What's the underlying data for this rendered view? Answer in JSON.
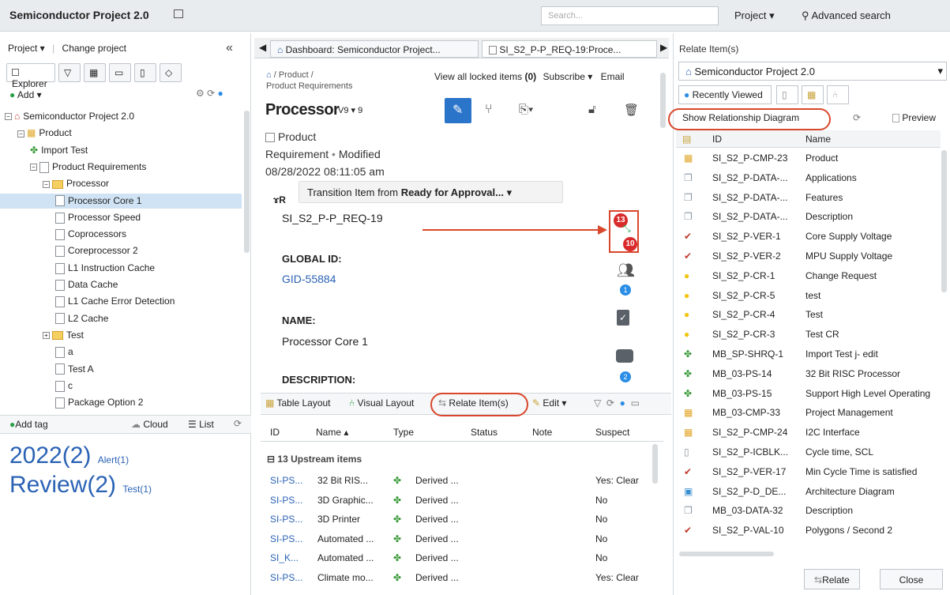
{
  "topbar": {
    "title": "Semiconductor Project 2.0",
    "search_placeholder": "Search...",
    "scope": "Project",
    "advanced": "Advanced search"
  },
  "left": {
    "project_menu": "Project ▾",
    "change_project": "Change project",
    "collapse": "«",
    "explorer_tab": "Explorer",
    "add": "Add ▾",
    "tree": [
      {
        "label": "Semiconductor Project 2.0",
        "level": 0,
        "kind": "project",
        "expander": "−"
      },
      {
        "label": "Product",
        "level": 1,
        "kind": "folder-grid",
        "expander": "−"
      },
      {
        "label": "Import Test",
        "level": 2,
        "kind": "puzzle",
        "expander": ""
      },
      {
        "label": "Product Requirements",
        "level": 2,
        "kind": "doc",
        "expander": "−"
      },
      {
        "label": "Processor",
        "level": 3,
        "kind": "folder",
        "expander": "−"
      },
      {
        "label": "Processor Core 1",
        "level": 4,
        "kind": "doc",
        "expander": "",
        "selected": true
      },
      {
        "label": "Processor Speed",
        "level": 4,
        "kind": "doc",
        "expander": ""
      },
      {
        "label": "Coprocessors",
        "level": 4,
        "kind": "doc",
        "expander": ""
      },
      {
        "label": "Coreprocessor 2",
        "level": 4,
        "kind": "doc",
        "expander": ""
      },
      {
        "label": "L1 Instruction Cache",
        "level": 4,
        "kind": "doc",
        "expander": ""
      },
      {
        "label": "Data Cache",
        "level": 4,
        "kind": "doc",
        "expander": ""
      },
      {
        "label": "L1 Cache Error Detection",
        "level": 4,
        "kind": "doc",
        "expander": ""
      },
      {
        "label": "L2 Cache",
        "level": 4,
        "kind": "doc",
        "expander": ""
      },
      {
        "label": "Test",
        "level": 3,
        "kind": "folder",
        "expander": "+"
      },
      {
        "label": "a",
        "level": 4,
        "kind": "doc",
        "expander": ""
      },
      {
        "label": "Test A",
        "level": 4,
        "kind": "doc",
        "expander": ""
      },
      {
        "label": "c",
        "level": 4,
        "kind": "doc",
        "expander": ""
      },
      {
        "label": "Package Option 2",
        "level": 4,
        "kind": "doc",
        "expander": ""
      }
    ],
    "add_tag": "Add tag",
    "cloud": "Cloud",
    "list": "List",
    "tag1_big": "2022(2)",
    "tag1_small": "Alert(1)",
    "tag2_big": "Review(2)",
    "tag2_small": "Test(1)"
  },
  "middle": {
    "tab1": "Dashboard: Semiconductor Project...",
    "tab2": "SI_S2_P-P_REQ-19:Proce...",
    "crumb1": "/ Product /",
    "crumb2": "Product Requirements",
    "view_locked": "View all locked items",
    "locked_count": "(0)",
    "subscribe": "Subscribe ▾",
    "email": "Email",
    "title_overlap": "Processor",
    "version": "V9 ▾ 9",
    "item_type": "Product",
    "item_type2": "Requirement",
    "status": "Modified",
    "datetime": "08/28/2022 08:11:05 am",
    "transition_prefix": "Transition Item from ",
    "transition_state": "Ready for Approval...",
    "id_value": "SI_S2_P-P_REQ-19",
    "global_id_label": "GLOBAL ID:",
    "global_id_value": "GID-55884",
    "name_label": "NAME:",
    "name_value": "Processor Core 1",
    "desc_label": "DESCRIPTION:",
    "badge_top": "13",
    "badge_bottom": "10",
    "badge_people": "1",
    "badge_comments": "2",
    "table_layout": "Table Layout",
    "visual_layout": "Visual Layout",
    "relate_items": "Relate Item(s)",
    "edit": "Edit ▾",
    "columns": [
      "ID",
      "Name ▴",
      "Type",
      "Status",
      "Note",
      "Suspect"
    ],
    "group": "13 Upstream items",
    "rows": [
      {
        "id": "SI-PS...",
        "name": "32 Bit RIS...",
        "type": "Derived ...",
        "suspect": "Yes: Clear"
      },
      {
        "id": "SI-PS...",
        "name": "3D Graphic...",
        "type": "Derived ...",
        "suspect": "No"
      },
      {
        "id": "SI-PS...",
        "name": "3D Printer",
        "type": "Derived ...",
        "suspect": "No"
      },
      {
        "id": "SI-PS...",
        "name": "Automated ...",
        "type": "Derived ...",
        "suspect": "No"
      },
      {
        "id": "SI_K...",
        "name": "Automated ...",
        "type": "Derived ...",
        "suspect": "No"
      },
      {
        "id": "SI-PS...",
        "name": "Climate mo...",
        "type": "Derived ...",
        "suspect": "Yes: Clear"
      }
    ]
  },
  "right": {
    "header": "Relate Item(s)",
    "project": "Semiconductor Project 2.0",
    "recent_tab": "Recently Viewed",
    "show_diagram": "Show Relationship Diagram",
    "preview": "Preview",
    "col_id": "ID",
    "col_name": "Name",
    "rows": [
      {
        "id": "SI_S2_P-CMP-23",
        "name": "Product",
        "icon": "grid"
      },
      {
        "id": "SI_S2_P-DATA-...",
        "name": "Applications",
        "icon": "docs"
      },
      {
        "id": "SI_S2_P-DATA-...",
        "name": "Features",
        "icon": "docs"
      },
      {
        "id": "SI_S2_P-DATA-...",
        "name": "Description",
        "icon": "docs"
      },
      {
        "id": "SI_S2_P-VER-1",
        "name": "Core Supply Voltage",
        "icon": "check"
      },
      {
        "id": "SI_S2_P-VER-2",
        "name": "MPU Supply Voltage",
        "icon": "check"
      },
      {
        "id": "SI_S2_P-CR-1",
        "name": "Change Request",
        "icon": "bulb"
      },
      {
        "id": "SI_S2_P-CR-5",
        "name": "test",
        "icon": "bulb"
      },
      {
        "id": "SI_S2_P-CR-4",
        "name": "Test",
        "icon": "bulb"
      },
      {
        "id": "SI_S2_P-CR-3",
        "name": "Test CR",
        "icon": "bulb"
      },
      {
        "id": "MB_SP-SHRQ-1",
        "name": "Import Test j- edit",
        "icon": "puzzle"
      },
      {
        "id": "MB_03-PS-14",
        "name": "32 Bit RISC Processor",
        "icon": "puzzle"
      },
      {
        "id": "MB_03-PS-15",
        "name": "Support High Level Operating",
        "icon": "puzzle"
      },
      {
        "id": "MB_03-CMP-33",
        "name": "Project Management",
        "icon": "grid"
      },
      {
        "id": "SI_S2_P-CMP-24",
        "name": "I2C Interface",
        "icon": "grid"
      },
      {
        "id": "SI_S2_P-ICBLK...",
        "name": "Cycle time, SCL",
        "icon": "page"
      },
      {
        "id": "SI_S2_P-VER-17",
        "name": "Min Cycle Time is satisfied",
        "icon": "check"
      },
      {
        "id": "SI_S2_P-D_DE...",
        "name": "Architecture Diagram",
        "icon": "image"
      },
      {
        "id": "MB_03-DATA-32",
        "name": "Description",
        "icon": "docs"
      },
      {
        "id": "SI_S2_P-VAL-10",
        "name": "Polygons / Second 2",
        "icon": "check"
      }
    ],
    "relate_btn": "Relate",
    "close_btn": "Close"
  }
}
